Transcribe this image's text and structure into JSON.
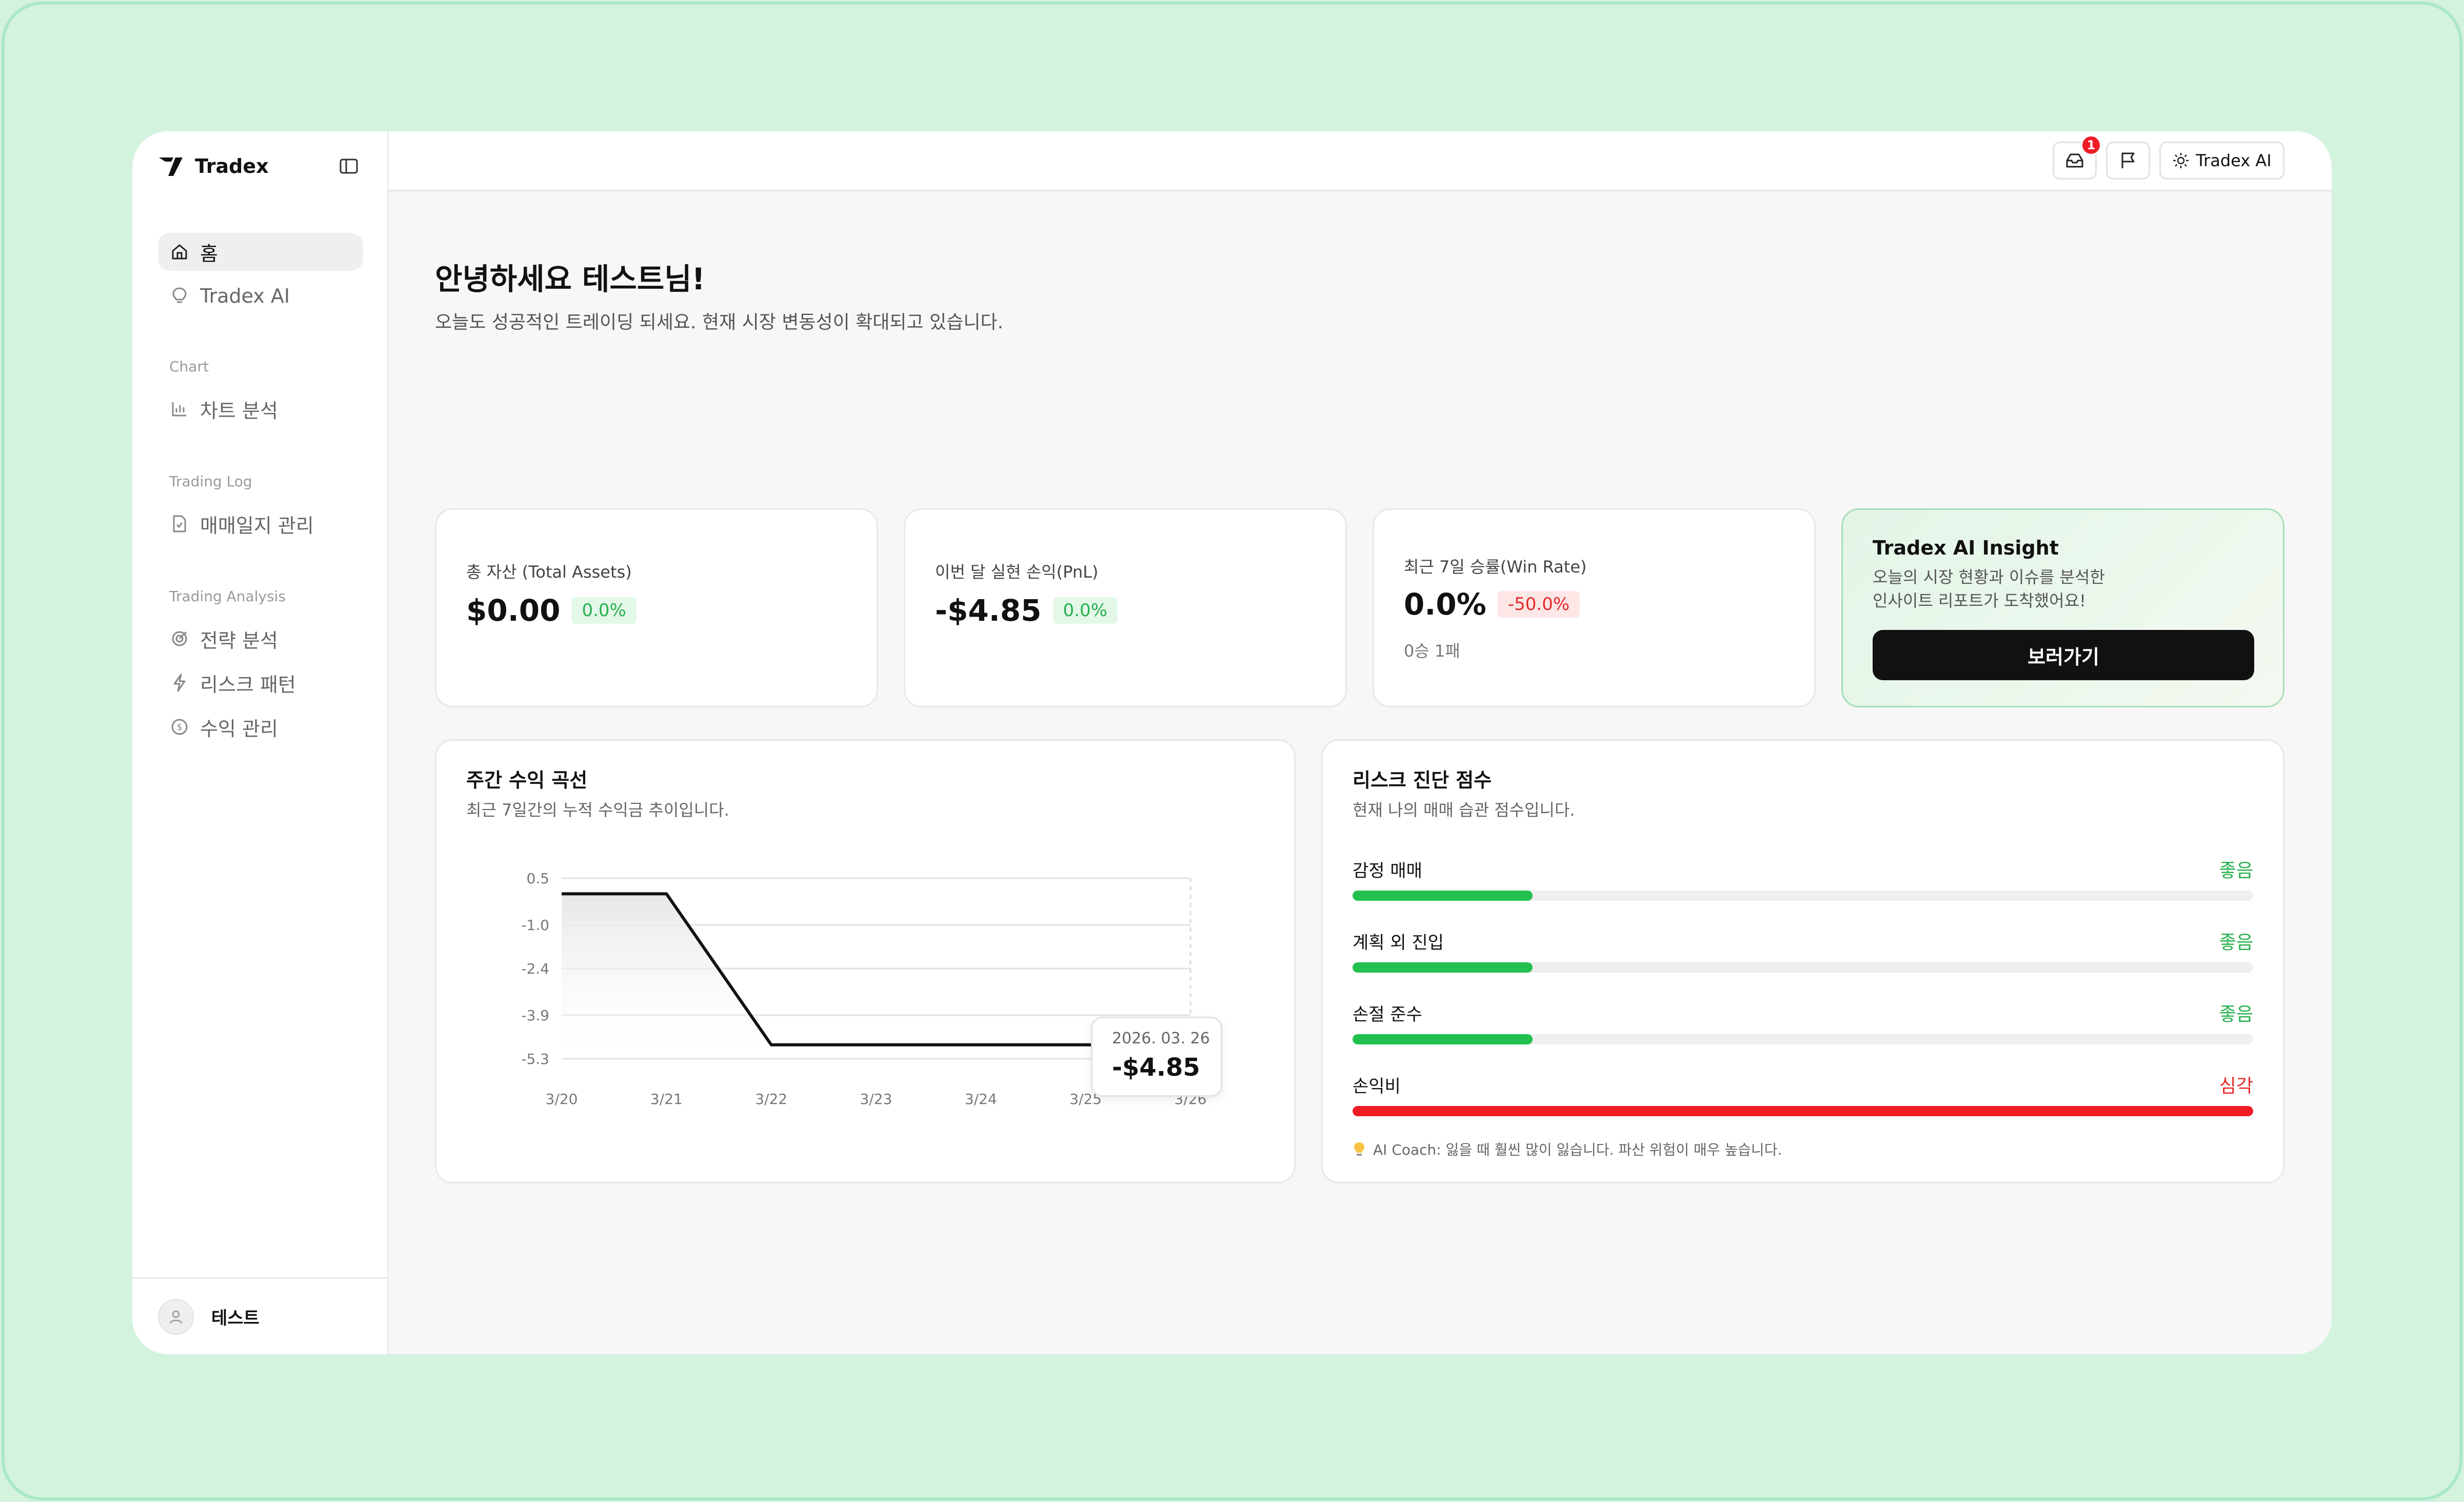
{
  "app": {
    "name": "Tradex"
  },
  "sidebar": {
    "items_top": [
      {
        "label": "홈",
        "icon": "home-icon",
        "active": true
      },
      {
        "label": "Tradex AI",
        "icon": "lightbulb-icon",
        "active": false
      }
    ],
    "sections": [
      {
        "title": "Chart",
        "items": [
          {
            "label": "차트 분석",
            "icon": "bar-chart-icon"
          }
        ]
      },
      {
        "title": "Trading Log",
        "items": [
          {
            "label": "매매일지 관리",
            "icon": "file-icon"
          }
        ]
      },
      {
        "title": "Trading Analysis",
        "items": [
          {
            "label": "전략 분석",
            "icon": "target-icon"
          },
          {
            "label": "리스크 패턴",
            "icon": "lightning-icon"
          },
          {
            "label": "수익 관리",
            "icon": "dollar-circle-icon"
          }
        ]
      }
    ],
    "user": {
      "name": "테스트"
    }
  },
  "header": {
    "notifications_count": "1",
    "ai_button_label": "Tradex AI"
  },
  "main": {
    "greeting": "안녕하세요 테스트님!",
    "subtitle": "오늘도 성공적인 트레이딩 되세요. 현재 시장 변동성이 확대되고 있습니다.",
    "stats": [
      {
        "label": "총 자산 (Total Assets)",
        "value": "$0.00",
        "change": "0.0%",
        "change_color": "green"
      },
      {
        "label": "이번 달 실현 손익(PnL)",
        "value": "-$4.85",
        "change": "0.0%",
        "change_color": "green"
      },
      {
        "label": "최근 7일 승률(Win Rate)",
        "value": "0.0%",
        "change": "-50.0%",
        "change_color": "red",
        "sub": "0승 1패"
      }
    ],
    "insight": {
      "title": "Tradex AI Insight",
      "desc_line1": "오늘의 시장 현황과 이슈를 분석한",
      "desc_line2": "인사이트 리포트가 도착했어요!",
      "button": "보러가기"
    },
    "weekly": {
      "title": "주간 수익 곡선",
      "subtitle": "최근 7일간의 누적 수익금 추이입니다.",
      "tooltip_date": "2026. 03. 26",
      "tooltip_value": "-$4.85"
    },
    "risk": {
      "title": "리스크 진단 점수",
      "subtitle": "현재 나의 매매 습관 점수입니다.",
      "rows": [
        {
          "label": "감정 매매",
          "status": "좋음",
          "level": 0.2,
          "color": "#22c04e",
          "status_color": "#27b04e"
        },
        {
          "label": "계획 외 진입",
          "status": "좋음",
          "level": 0.2,
          "color": "#22c04e",
          "status_color": "#27b04e"
        },
        {
          "label": "손절 준수",
          "status": "좋음",
          "level": 0.2,
          "color": "#22c04e",
          "status_color": "#27b04e"
        },
        {
          "label": "손익비",
          "status": "심각",
          "level": 1.0,
          "color": "#ef1c26",
          "status_color": "#e52a2a"
        }
      ],
      "coach": "AI Coach: 잃을 때 훨씬 많이 잃습니다. 파산 위험이 매우 높습니다."
    }
  },
  "chart_data": {
    "type": "line",
    "title": "주간 수익 곡선",
    "x": [
      "3/20",
      "3/21",
      "3/22",
      "3/23",
      "3/24",
      "3/25",
      "3/26"
    ],
    "series": [
      {
        "values": [
          0,
          0,
          -4.85,
          -4.85,
          -4.85,
          -4.85,
          -4.85
        ]
      }
    ],
    "yticks": [
      "0.5",
      "-1.0",
      "-2.4",
      "-3.9",
      "-5.3"
    ],
    "ylim": [
      -5.3,
      0.5
    ],
    "grid": true,
    "tooltip": {
      "date": "2026. 03. 26",
      "value": "-$4.85"
    }
  }
}
